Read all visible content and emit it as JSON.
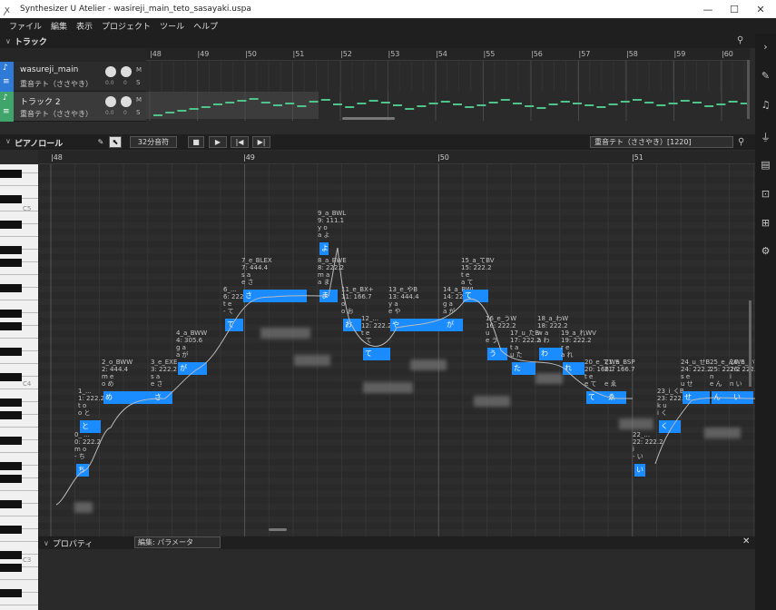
{
  "window": {
    "title": "Synthesizer U Atelier - wasireji_main_teto_sasayaki.uspa",
    "minimize": "—",
    "maximize": "☐",
    "close": "✕"
  },
  "menu": [
    "ファイル",
    "編集",
    "表示",
    "プロジェクト",
    "ツール",
    "ヘルプ"
  ],
  "track_panel": {
    "title": "トラック",
    "collapse_icon": "chevron-down-icon"
  },
  "tracks": [
    {
      "name": "wasureji_main",
      "singer": "重音テト（ささやき）",
      "color": "#2e7ad6",
      "vol": "0.0",
      "pan": "0",
      "m": "M",
      "s": "S"
    },
    {
      "name": "トラック 2",
      "singer": "重音テト（ささやき）",
      "color": "#3fa56b",
      "vol": "0.0",
      "pan": "0",
      "m": "M",
      "s": "S"
    }
  ],
  "arranger_markers": [
    "48",
    "49",
    "50",
    "51",
    "52",
    "53",
    "54",
    "55",
    "56",
    "57",
    "58",
    "59",
    "60"
  ],
  "piano_roll": {
    "title": "ピアノロール",
    "snap": "32分音符",
    "singer_select": "重音テト（ささやき）[1220]",
    "markers": [
      "48",
      "49",
      "50",
      "51"
    ],
    "key_labels": [
      "C5",
      "C4",
      "C3"
    ]
  },
  "notes": [
    {
      "lyric": "ち",
      "label": "0_ ...\n0: 222.2\nm o\n- ち"
    },
    {
      "lyric": "と",
      "label": "1_...\n1: 222.2\nt o\no と"
    },
    {
      "lyric": "め",
      "label": "2_o_BWW\n2: 444.4\nm e\no め"
    },
    {
      "lyric": "さ",
      "label": "3_e_EXE\n3: 222.2\ns a\ne さ"
    },
    {
      "lyric": "が",
      "label": "4_a_BWW\n4: 305.6\ng a\na が"
    },
    {
      "lyric": "て",
      "label": "6_...\n6: 222.2\nt e\n- て"
    },
    {
      "lyric": "さ",
      "label": "7_e_BLEX\n7: 444.4\ns a\ne さ"
    },
    {
      "lyric": "ま",
      "label": "8_a_BWE\n8: 222.2\nm a\na ま"
    },
    {
      "lyric": "よ",
      "label": "9_a_BWL\n9: 111.1\ny o\na よ"
    },
    {
      "lyric": "お",
      "label": "11_e_BX+\n11: 166.7\no\no お"
    },
    {
      "lyric": "て",
      "label": "12_...\n12: 222.2\nt e\n- て"
    },
    {
      "lyric": "や",
      "label": "13_e_やB\n13: 444.4\ny a\ne や"
    },
    {
      "lyric": "が",
      "label": "14_a_BWL\n14: 222.2\ng a\na が"
    },
    {
      "lyric": "て",
      "label": "15_a_てBV\n15: 222.2\nt e\na て"
    },
    {
      "lyric": "う",
      "label": "16_e_うW\n16: 222.2\nu\ne う"
    },
    {
      "lyric": "た",
      "label": "17_u_たB\n17: 222.2\nt a\nu た"
    },
    {
      "lyric": "わ",
      "label": "18_a_わW\n18: 222.2\nw a\na わ"
    },
    {
      "lyric": "れ",
      "label": "19_a_れWV\n19: 222.2\nr e\na れ"
    },
    {
      "lyric": "て",
      "label": "20_e_てWS\n20: 166.7\nt e\ne て"
    },
    {
      "lyric": "ゑ",
      "label": "21_e_BSP\n21: 166.7\n\ne ゑ"
    },
    {
      "lyric": "い",
      "label": "22_...\n22: 222.2\ni\n- い"
    },
    {
      "lyric": "く",
      "label": "23_i_くB\n23: 222.2\nk u\ni く"
    },
    {
      "lyric": "せ",
      "label": "24_u_せB\n24: 222.2\ns e\nu せ"
    },
    {
      "lyric": "ん",
      "label": "25_e_んWE\n25: 222.2\nn\ne ん"
    },
    {
      "lyric": "い",
      "label": "26_n_いW\n26: 222.2\ni\nn い"
    }
  ],
  "properties": {
    "title": "プロパティ",
    "edit_select": "編集: パラメータ",
    "close": "✕"
  },
  "colors": {
    "note": "#1a8cff",
    "bg": "#2d2d2d",
    "arr_note": "#4fc48a"
  }
}
